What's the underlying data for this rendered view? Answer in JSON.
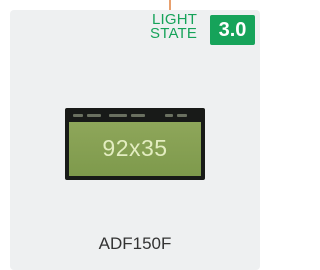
{
  "status": {
    "line1": "LIGHT",
    "line2": "STATE",
    "badge": "3.0"
  },
  "lcd": {
    "value": "92x35"
  },
  "product": {
    "model": "ADF150F"
  },
  "colors": {
    "accent": "#16a35a",
    "lcd_green": "#8ea65a",
    "card_bg": "#eef0f1"
  }
}
